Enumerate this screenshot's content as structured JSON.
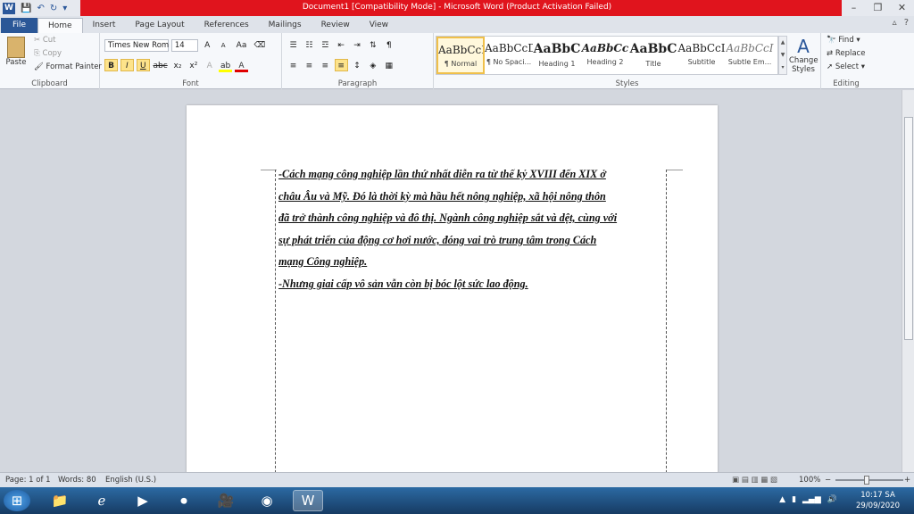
{
  "window": {
    "title": "Document1 [Compatibility Mode] - Microsoft Word (Product Activation Failed)",
    "app_icon": "W",
    "title_bar_color": "#e0141d"
  },
  "tabs": [
    "File",
    "Home",
    "Insert",
    "Page Layout",
    "References",
    "Mailings",
    "Review",
    "View"
  ],
  "clipboard": {
    "paste": "Paste",
    "cut": "Cut",
    "copy": "Copy",
    "format_painter": "Format Painter",
    "label": "Clipboard"
  },
  "font": {
    "family": "Times New Rom",
    "size": "14",
    "label": "Font",
    "bold": "B",
    "italic": "I",
    "underline": "U",
    "strike": "abc",
    "sub": "x₂",
    "sup": "x²",
    "grow": "A",
    "shrink": "A",
    "case": "Aa"
  },
  "paragraph": {
    "label": "Paragraph",
    "pilcrow": "¶"
  },
  "styles": {
    "label": "Styles",
    "items": [
      {
        "sample": "AaBbCcDc",
        "name": "¶ Normal"
      },
      {
        "sample": "AaBbCcDc",
        "name": "¶ No Spaci..."
      },
      {
        "sample": "AaBbC",
        "name": "Heading 1"
      },
      {
        "sample": "AaBbCc",
        "name": "Heading 2"
      },
      {
        "sample": "AaBbC",
        "name": "Title"
      },
      {
        "sample": "AaBbCcI",
        "name": "Subtitle"
      },
      {
        "sample": "AaBbCcI",
        "name": "Subtle Em..."
      }
    ],
    "change_styles": "Change Styles"
  },
  "editing": {
    "find": "Find",
    "replace": "Replace",
    "select": "Select",
    "label": "Editing"
  },
  "document": {
    "lines": [
      " -Cách mạng công nghiệp lần thứ nhất diễn ra từ thế kỷ XVIII đến XIX ở",
      "châu Âu và Mỹ. Đó là thời kỳ mà hầu hết nông nghiệp, xã hội nông thôn",
      "đã trở thành công nghiệp và đô thị. Ngành công nghiệp sắt và dệt, cùng với",
      "sự phát triển của động cơ hơi nước, đóng vai trò trung tâm trong Cách",
      "mạng Công nghiệp.",
      "  -Nhưng giai cấp vô sản vẫn còn bị bóc lột sức lao động."
    ]
  },
  "status": {
    "page": "Page: 1 of 1",
    "words": "Words: 80",
    "language": "English (U.S.)",
    "zoom": "100%",
    "zoom_minus": "−",
    "zoom_plus": "+"
  },
  "taskbar": {
    "time": "10:17 SA",
    "date": "29/09/2020"
  }
}
